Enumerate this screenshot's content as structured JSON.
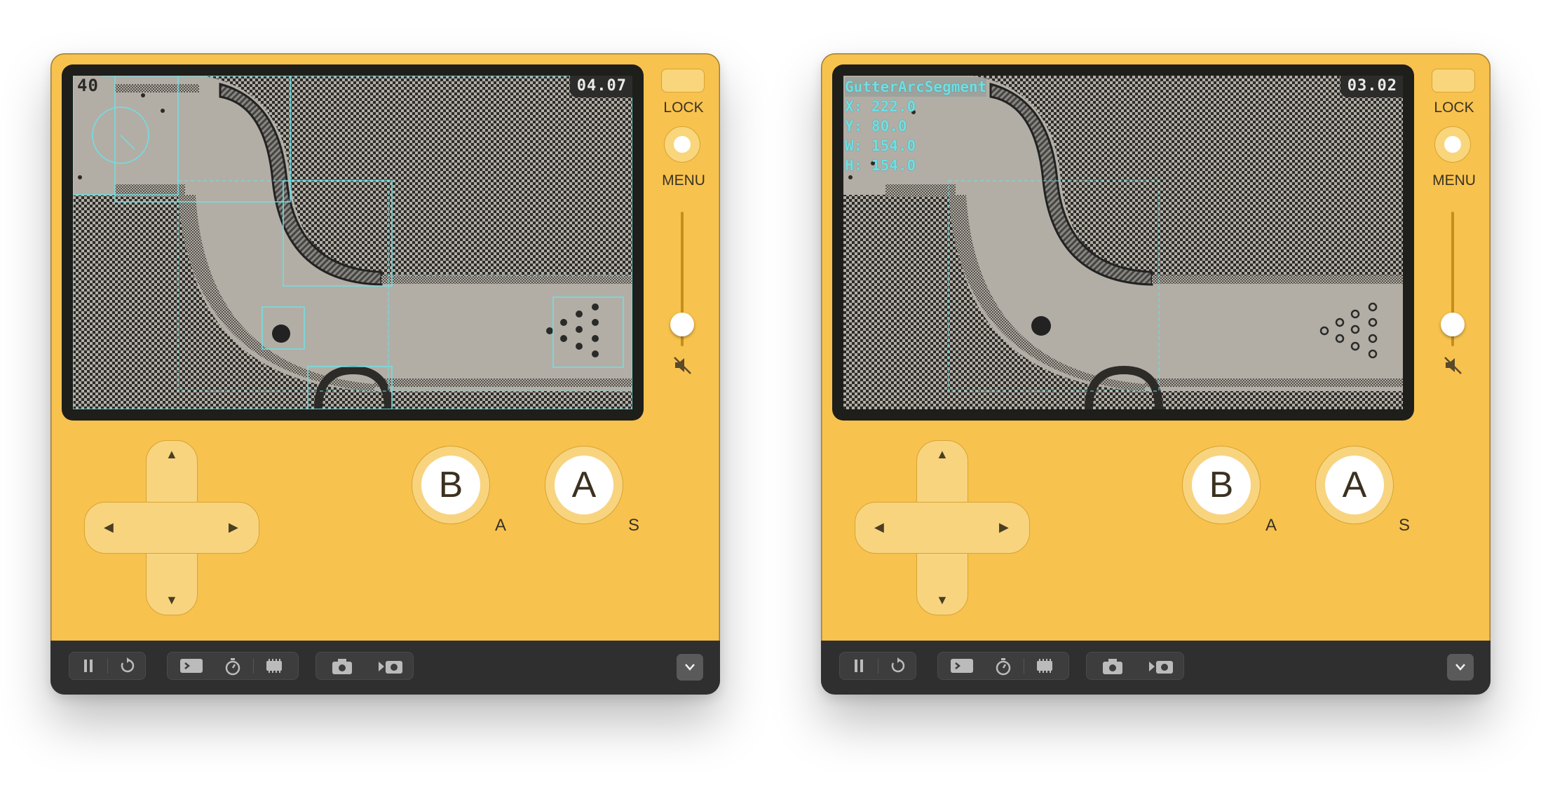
{
  "simulators": [
    {
      "id": "left",
      "hud_left": "40",
      "hud_right": "04.07",
      "lock_label": "LOCK",
      "menu_label": "MENU",
      "button_b": "B",
      "button_a": "A",
      "key_b": "A",
      "key_a": "S",
      "inspector": null
    },
    {
      "id": "right",
      "hud_left": "",
      "hud_right": "03.02",
      "lock_label": "LOCK",
      "menu_label": "MENU",
      "button_b": "B",
      "button_a": "A",
      "key_b": "A",
      "key_a": "S",
      "inspector": {
        "title": "GutterArcSegment",
        "x": "X: 222.0",
        "y": "Y: 80.0",
        "w": "W: 154.0",
        "h": "H: 154.0"
      }
    }
  ],
  "toolbar": {
    "icons": [
      "pause-icon",
      "restart-icon",
      "console-icon",
      "stopwatch-icon",
      "memory-icon",
      "camera-icon",
      "record-video-icon",
      "chevron-down-icon"
    ]
  },
  "colors": {
    "device": "#f8c24e",
    "bezel": "#1e1e1b",
    "screen": "#b2aea6",
    "debug_overlay": "#6fe0e4",
    "toolbar": "#2f2f2f"
  }
}
